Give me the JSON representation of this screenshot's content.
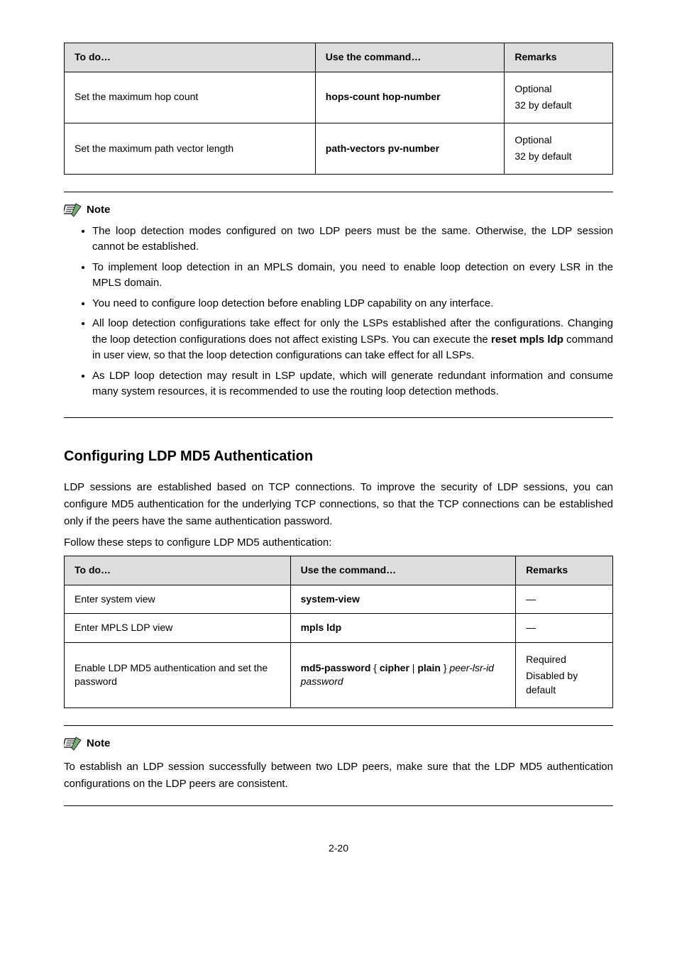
{
  "table1": {
    "headers": [
      "To do…",
      "Use the command…",
      "Remarks"
    ],
    "rows": [
      {
        "c0": "Set the maximum hop count",
        "c1": "hops-count hop-number",
        "r1": "Optional",
        "r2": "32 by default"
      },
      {
        "c0": "Set the maximum path vector length",
        "c1": "path-vectors pv-number",
        "r1": "Optional",
        "r2": "32 by default"
      }
    ]
  },
  "noteLabel": "Note",
  "notes1": {
    "b1": "The loop detection modes configured on two LDP peers must be the same. Otherwise, the LDP session cannot be established.",
    "b2": "To implement loop detection in an MPLS domain, you need to enable loop detection on every LSR in the MPLS domain.",
    "b3": "You need to configure loop detection before enabling LDP capability on any interface.",
    "b4a": "All loop detection configurations take effect for only the LSPs established after the configurations. Changing the loop detection configurations does not affect existing LSPs. You can execute the ",
    "b4cmd": "reset mpls ldp",
    "b4b": " command in user view, so that the loop detection configurations can take effect for all LSPs.",
    "b5": "As LDP loop detection may result in LSP update, which will generate redundant information and consume many system resources, it is recommended to use the routing loop detection methods."
  },
  "sectionTitle": "Configuring LDP MD5 Authentication",
  "para1": "LDP sessions are established based on TCP connections. To improve the security of LDP sessions, you can configure MD5 authentication for the underlying TCP connections, so that the TCP connections can be established only if the peers have the same authentication password.",
  "para2": "Follow these steps to configure LDP MD5 authentication:",
  "table2": {
    "headers": [
      "To do…",
      "Use the command…",
      "Remarks"
    ],
    "rows": [
      {
        "c0": "Enter system view",
        "c1": "system-view",
        "c2": "—"
      },
      {
        "c0": "Enter MPLS LDP view",
        "c1": "mpls ldp",
        "c2": "—"
      },
      {
        "c0": "Enable LDP MD5 authentication and set the password",
        "c1a": "md5-password",
        "c1b": " { ",
        "c1c": "cipher",
        "c1d": " | ",
        "c1e": "plain",
        "c1f": " } ",
        "c1g": "peer-lsr-id password",
        "r1": "Required",
        "r2": "Disabled by default"
      }
    ]
  },
  "notes2": "To establish an LDP session successfully between two LDP peers, make sure that the LDP MD5 authentication configurations on the LDP peers are consistent.",
  "pageNumber": "2-20"
}
